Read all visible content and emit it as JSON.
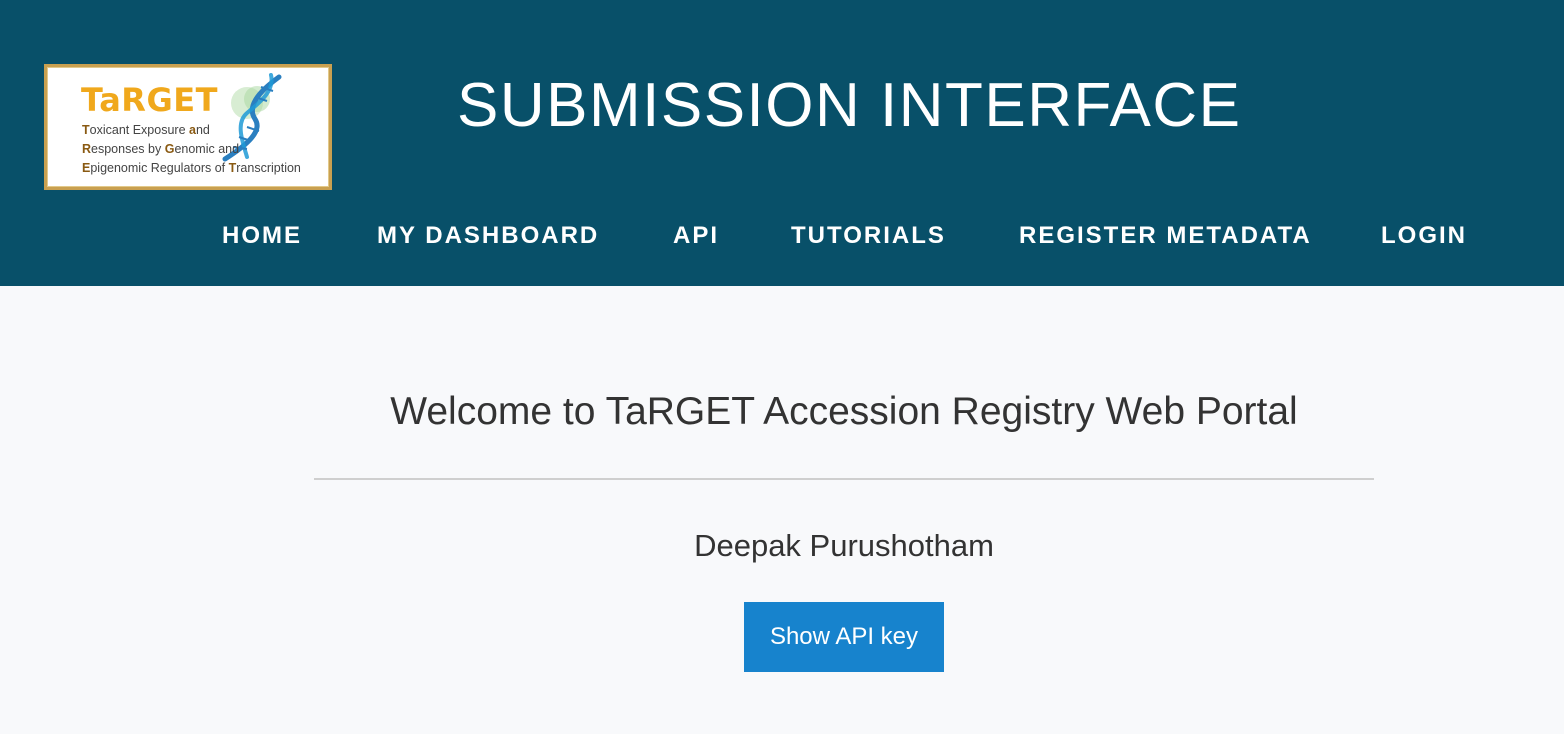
{
  "logo": {
    "title": "TaRGET",
    "line1_parts": [
      "T",
      "oxicant Exposure ",
      "a",
      "nd"
    ],
    "line2_parts": [
      "R",
      "esponses by ",
      "G",
      "enomic and"
    ],
    "line3_parts": [
      "E",
      "pigenomic Regulators of ",
      "T",
      "ranscription"
    ],
    "title_color": "#f0a81c",
    "border_color": "#c9a050"
  },
  "header": {
    "title": "SUBMISSION INTERFACE",
    "background_color": "#085069"
  },
  "nav": {
    "items": [
      {
        "label": "HOME"
      },
      {
        "label": "MY DASHBOARD"
      },
      {
        "label": "API"
      },
      {
        "label": "TUTORIALS"
      },
      {
        "label": "REGISTER METADATA"
      },
      {
        "label": "LOGIN"
      }
    ]
  },
  "main": {
    "welcome": "Welcome to TaRGET Accession Registry Web Portal",
    "username": "Deepak Purushotham",
    "api_button_label": "Show API key",
    "button_color": "#1783cd",
    "background_color": "#f8f9fb"
  }
}
